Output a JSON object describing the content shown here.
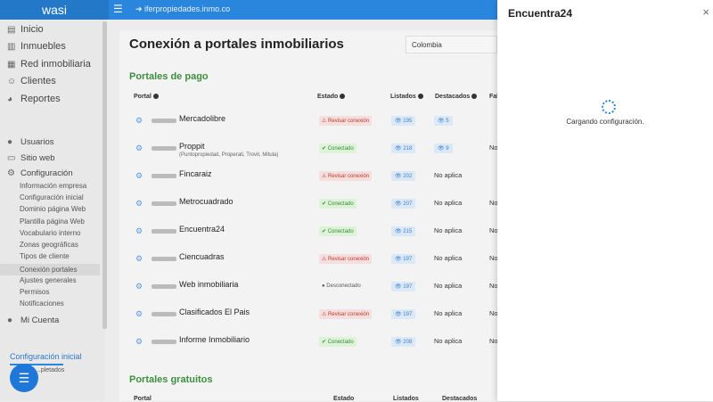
{
  "header": {
    "logo": "wasi",
    "url": "iferpropiedades.inmo.co"
  },
  "sidebar": {
    "main": [
      {
        "label": "Inicio",
        "icon": "▤"
      },
      {
        "label": "Inmuebles",
        "icon": "▥"
      },
      {
        "label": "Red inmobiliaria",
        "icon": "▦"
      },
      {
        "label": "Clientes",
        "icon": "☺"
      },
      {
        "label": "Reportes",
        "icon": "◕"
      }
    ],
    "secondary": [
      {
        "label": "Usuarios",
        "icon": "●"
      },
      {
        "label": "Sitio web",
        "icon": "▭"
      },
      {
        "label": "Configuración",
        "icon": "⚙"
      }
    ],
    "sub": [
      "Información empresa",
      "Configuración inicial",
      "Dominio página Web",
      "Plantilla página Web",
      "Vocabulario interno",
      "Zonas geográficas",
      "Tipos de cliente",
      "Conexión portales",
      "Ajustes generales",
      "Permisos",
      "Notificaciones"
    ],
    "account": "Mi Cuenta",
    "config_inicial": "Configuración inicial",
    "config_sub": "...pletados"
  },
  "page": {
    "title": "Conexión a portales inmobiliarios",
    "country": "Colombia",
    "paid_title": "Portales de pago",
    "free_title": "Portales gratuitos",
    "columns": {
      "portal": "Portal",
      "estado": "Estado",
      "listados": "Listados",
      "destacados": "Destacados",
      "fal": "Fal"
    }
  },
  "portals": [
    {
      "name": "Mercadolibre",
      "sub": "",
      "status": "Revisar conexión",
      "st": "warn",
      "listados": "195",
      "destacados": "5",
      "dbadge": true,
      "fal": ""
    },
    {
      "name": "Proppit",
      "sub": "(Puntopropiedad, Properati, Trovit, Mitula)",
      "status": "Conectado",
      "st": "ok",
      "listados": "218",
      "destacados": "9",
      "dbadge": true,
      "fal": "No"
    },
    {
      "name": "Fincaraiz",
      "sub": "",
      "status": "Revisar conexión",
      "st": "warn",
      "listados": "202",
      "destacados": "No aplica",
      "dbadge": false,
      "fal": ""
    },
    {
      "name": "Metrocuadrado",
      "sub": "",
      "status": "Conectado",
      "st": "ok",
      "listados": "207",
      "destacados": "No aplica",
      "dbadge": false,
      "fal": "No"
    },
    {
      "name": "Encuentra24",
      "sub": "",
      "status": "Conectado",
      "st": "ok",
      "listados": "215",
      "destacados": "No aplica",
      "dbadge": false,
      "fal": "No"
    },
    {
      "name": "Ciencuadras",
      "sub": "",
      "status": "Revisar conexión",
      "st": "warn",
      "listados": "197",
      "destacados": "No aplica",
      "dbadge": false,
      "fal": "No"
    },
    {
      "name": "Web inmobiliaria",
      "sub": "",
      "status": "Desconectado",
      "st": "off",
      "listados": "197",
      "destacados": "No aplica",
      "dbadge": false,
      "fal": "No"
    },
    {
      "name": "Clasificados El Pais",
      "sub": "",
      "status": "Revisar conexión",
      "st": "warn",
      "listados": "197",
      "destacados": "No aplica",
      "dbadge": false,
      "fal": "No"
    },
    {
      "name": "Informe Inmobiliario",
      "sub": "",
      "status": "Conectado",
      "st": "ok",
      "listados": "208",
      "destacados": "No aplica",
      "dbadge": false,
      "fal": "No"
    }
  ],
  "panel": {
    "title": "Encuentra24",
    "loading": "Cargando configuración."
  }
}
